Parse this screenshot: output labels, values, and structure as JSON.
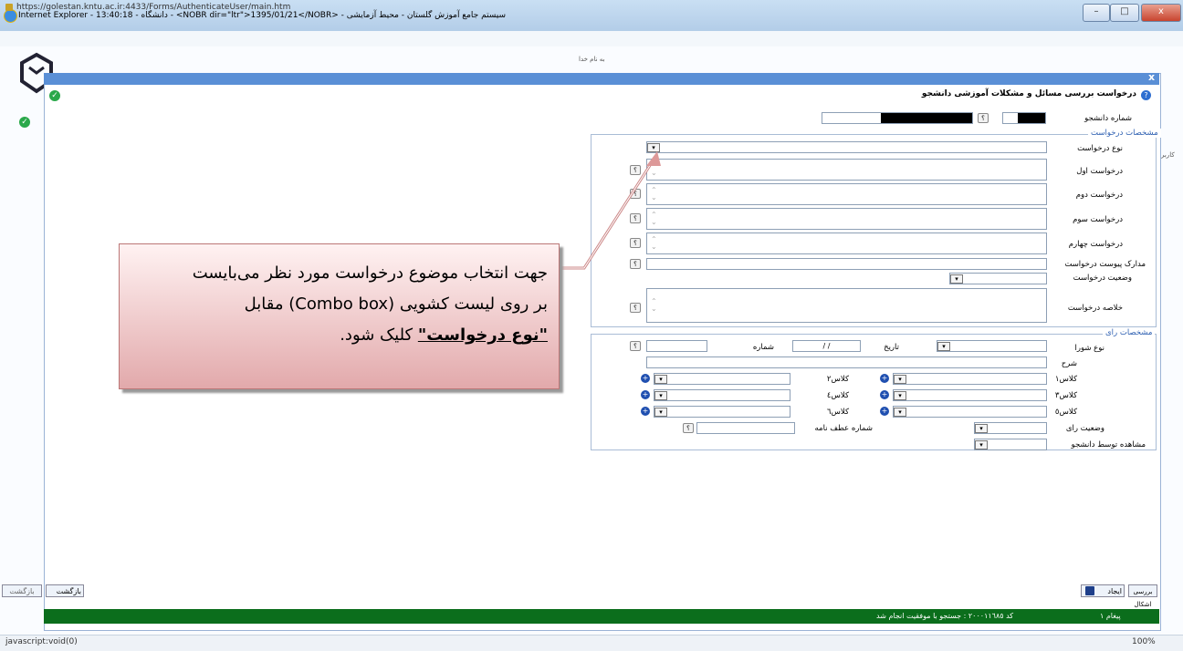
{
  "window": {
    "title": "Internet Explorer - دانشگاه - 13:40:18 - <NOBR dir=\"ltr\">1395/01/21</NOBR> - سیستم جامع آموزش گلستان - محیط آزمایشی",
    "minimize": "–",
    "maximize": "□",
    "close": "x"
  },
  "address": {
    "url": "https://golestan.kntu.ac.ir:4433/Forms/AuthenticateUser/main.htm"
  },
  "page": {
    "header": "به نام خدا",
    "right_side_label": "کاربر"
  },
  "dialog": {
    "title": "درخواست بررسی مسائل و مشکلات آموزشی دانشجو",
    "close": "x",
    "student_number_label": "شماره دانشجو",
    "request_section": {
      "legend": "مشخصات درخواست",
      "type_label": "نوع درخواست",
      "req1_label": "درخواست اول",
      "req2_label": "درخواست دوم",
      "req3_label": "درخواست سوم",
      "req4_label": "درخواست چهارم",
      "attachments_label": "مدارک پیوست درخواست",
      "status_label": "وضعیت درخواست",
      "summary_label": "خلاصه درخواست"
    },
    "vote_section": {
      "legend": "مشخصات رای",
      "council_type_label": "نوع شورا",
      "date_label": "تاریخ",
      "date_value": "/ /",
      "number_label": "شماره",
      "desc_label": "شرح",
      "class1": "کلاس۱",
      "class2": "کلاس۲",
      "class3": "کلاس۳",
      "class4": "کلاس٤",
      "class5": "کلاس٥",
      "class6": "کلاس٦",
      "vote_status_label": "وضعیت رای",
      "letter_number_label": "شماره عطف نامه",
      "student_view_label": "مشاهده توسط دانشجو"
    },
    "buttons": {
      "review": "بررسی اشکال",
      "create": "ایجاد",
      "back": "بازگشت"
    },
    "status": {
      "message": "کد ۲۰۰۰۱۱٦۸٥ : جستجو با موفقیت انجام شد",
      "count": "۱ پیغام"
    }
  },
  "callout": {
    "line1": "جهت انتخاب موضوع درخواست مورد نظر می‌بایست",
    "line2": "بر روی لیست کشویی (Combo box) مقابل",
    "line3_bold": "\"نوع درخواست\"",
    "line3_rest": " کلیک شود."
  },
  "ie_status": {
    "left": "javascript:void(0)",
    "zoom": "100%"
  },
  "colors": {
    "dialog_header": "#5a8fd6",
    "status_green": "#0b6e1c",
    "callout_start": "#fff2f2",
    "callout_end": "#e2a9ab"
  }
}
